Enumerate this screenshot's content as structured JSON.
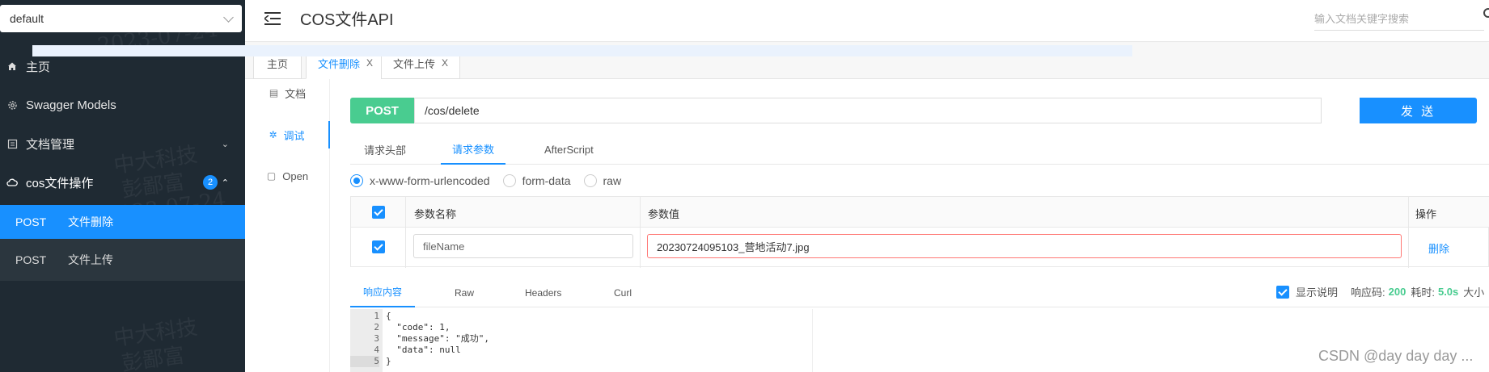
{
  "sidebar": {
    "group_select": "default",
    "items": [
      {
        "label": "主页"
      },
      {
        "label": "Swagger Models"
      },
      {
        "label": "文档管理"
      },
      {
        "label": "cos文件操作",
        "badge": "2"
      }
    ],
    "sub_items": [
      {
        "method": "POST",
        "name": "文件删除"
      },
      {
        "method": "POST",
        "name": "文件上传"
      }
    ],
    "watermark_lines": [
      "中大科技",
      "彭鄙富",
      "2023-07-24"
    ]
  },
  "header": {
    "title": "COS文件API",
    "search_placeholder": "输入文档关键字搜索"
  },
  "tabs": [
    {
      "label": "主页"
    },
    {
      "label": "文件删除",
      "close": "X"
    },
    {
      "label": "文件上传",
      "close": "X"
    }
  ],
  "doc_nav": [
    {
      "label": "文档"
    },
    {
      "label": "调试"
    },
    {
      "label": "Open"
    }
  ],
  "request": {
    "method": "POST",
    "url": "/cos/delete",
    "send_label": "发 送"
  },
  "request_tabs": [
    {
      "label": "请求头部"
    },
    {
      "label": "请求参数"
    },
    {
      "label": "AfterScript"
    }
  ],
  "content_types": [
    {
      "label": "x-www-form-urlencoded"
    },
    {
      "label": "form-data"
    },
    {
      "label": "raw"
    }
  ],
  "params_table": {
    "headers": {
      "name": "参数名称",
      "value": "参数值",
      "action": "操作"
    },
    "rows": [
      {
        "name": "fileName",
        "value": "20230724095103_营地活动7.jpg",
        "action": "删除"
      }
    ]
  },
  "response_tabs": [
    {
      "label": "响应内容"
    },
    {
      "label": "Raw"
    },
    {
      "label": "Headers"
    },
    {
      "label": "Curl"
    }
  ],
  "response_info": {
    "show_desc_label": "显示说明",
    "status_label": "响应码:",
    "status_value": "200",
    "time_label": "耗时:",
    "time_value": "5.0s",
    "size_label": "大小"
  },
  "response_body": {
    "line_numbers": [
      "1",
      "2",
      "3",
      "4",
      "5"
    ],
    "lines": [
      "{",
      "  \"code\": 1,",
      "  \"message\": \"成功\",",
      "  \"data\": null",
      "}"
    ]
  },
  "footer_watermark": "CSDN @day day day ...",
  "colors": {
    "sidebar_bg": "#1f2a33",
    "accent": "#1890ff",
    "post_green": "#49cc90"
  }
}
